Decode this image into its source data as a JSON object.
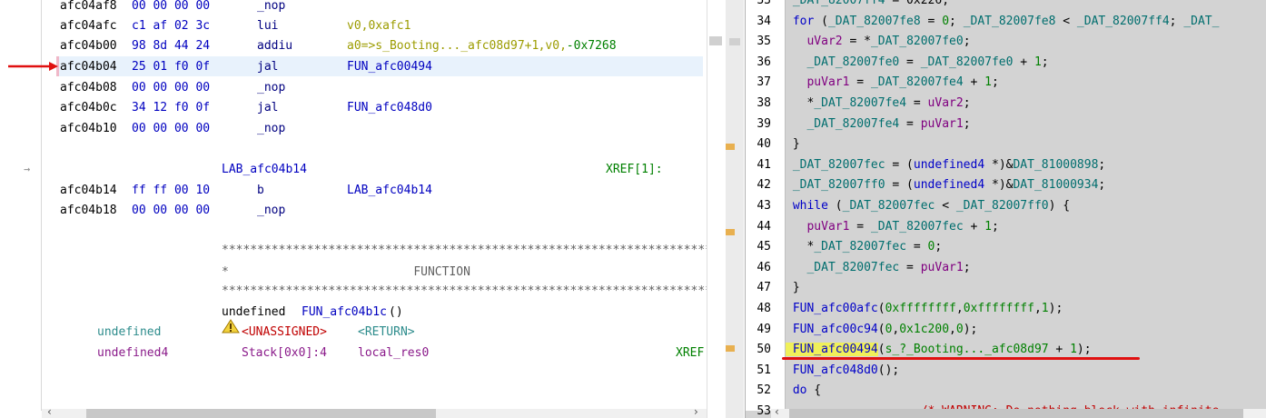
{
  "listing": {
    "rows": [
      {
        "addr": "afc04af8",
        "bytes": "00 00 00 00",
        "mnemonic": "_nop",
        "operand": ""
      },
      {
        "addr": "afc04afc",
        "bytes": "c1 af 02 3c",
        "mnemonic": "lui",
        "operand": "v0,0xafc1"
      },
      {
        "addr": "afc04b00",
        "bytes": "98 8d 44 24",
        "mnemonic": "addiu",
        "operand_a": "a0=>s_Booting..._afc08d97+1",
        "operand_b": ",v0,",
        "operand_c": "-0x7268"
      },
      {
        "addr": "afc04b04",
        "bytes": "25 01 f0 0f",
        "mnemonic": "jal",
        "operand": "FUN_afc00494"
      },
      {
        "addr": "afc04b08",
        "bytes": "00 00 00 00",
        "mnemonic": "_nop",
        "operand": ""
      },
      {
        "addr": "afc04b0c",
        "bytes": "34 12 f0 0f",
        "mnemonic": "jal",
        "operand": "FUN_afc048d0"
      },
      {
        "addr": "afc04b10",
        "bytes": "00 00 00 00",
        "mnemonic": "_nop",
        "operand": ""
      }
    ],
    "label": "LAB_afc04b14",
    "xref": "XREF[1]:",
    "rows2": [
      {
        "addr": "afc04b14",
        "bytes": "ff ff 00 10",
        "mnemonic": "b",
        "operand": "LAB_afc04b14"
      },
      {
        "addr": "afc04b18",
        "bytes": "00 00 00 00",
        "mnemonic": "_nop",
        "operand": ""
      }
    ],
    "stars": "**********************************************************************",
    "function_banner": "*                          FUNCTION",
    "signature_type": "undefined ",
    "signature_name": "FUN_afc04b1c",
    "signature_parens": "()",
    "ret_type": "undefined",
    "unassigned": "<UNASSIGNED>",
    "return_label": "<RETURN>",
    "param_type": "undefined4",
    "stack": "Stack[0x0]:4",
    "local": "local_res0",
    "xref_cut": "XREF"
  },
  "decompiler": {
    "lines": [
      {
        "n": "33",
        "parts": [
          [
            "gl",
            " _DAT_82007ff4"
          ],
          [
            "dc",
            " = 0x226;"
          ]
        ]
      },
      {
        "n": "34",
        "parts": [
          [
            "kw",
            " for"
          ],
          [
            "dc",
            " ("
          ],
          [
            "gl",
            "_DAT_82007fe8"
          ],
          [
            "dc",
            " = "
          ],
          [
            "num",
            "0"
          ],
          [
            "dc",
            "; "
          ],
          [
            "gl",
            "_DAT_82007fe8"
          ],
          [
            "dc",
            " < "
          ],
          [
            "gl",
            "_DAT_82007ff4"
          ],
          [
            "dc",
            "; "
          ],
          [
            "gl",
            "_DAT_"
          ]
        ]
      },
      {
        "n": "35",
        "parts": [
          [
            "var",
            "   uVar2"
          ],
          [
            "dc",
            " = *"
          ],
          [
            "gl",
            "_DAT_82007fe0"
          ],
          [
            "dc",
            ";"
          ]
        ]
      },
      {
        "n": "36",
        "parts": [
          [
            "gl",
            "   _DAT_82007fe0"
          ],
          [
            "dc",
            " = "
          ],
          [
            "gl",
            "_DAT_82007fe0"
          ],
          [
            "dc",
            " + "
          ],
          [
            "num",
            "1"
          ],
          [
            "dc",
            ";"
          ]
        ]
      },
      {
        "n": "37",
        "parts": [
          [
            "var",
            "   puVar1"
          ],
          [
            "dc",
            " = "
          ],
          [
            "gl",
            "_DAT_82007fe4"
          ],
          [
            "dc",
            " + "
          ],
          [
            "num",
            "1"
          ],
          [
            "dc",
            ";"
          ]
        ]
      },
      {
        "n": "38",
        "parts": [
          [
            "dc",
            "   *"
          ],
          [
            "gl",
            "_DAT_82007fe4"
          ],
          [
            "dc",
            " = "
          ],
          [
            "var",
            "uVar2"
          ],
          [
            "dc",
            ";"
          ]
        ]
      },
      {
        "n": "39",
        "parts": [
          [
            "gl",
            "   _DAT_82007fe4"
          ],
          [
            "dc",
            " = "
          ],
          [
            "var",
            "puVar1"
          ],
          [
            "dc",
            ";"
          ]
        ]
      },
      {
        "n": "40",
        "parts": [
          [
            "dc",
            " }"
          ]
        ]
      },
      {
        "n": "41",
        "parts": [
          [
            "gl",
            " _DAT_82007fec"
          ],
          [
            "dc",
            " = ("
          ],
          [
            "ty",
            "undefined4"
          ],
          [
            "dc",
            " *)&"
          ],
          [
            "gl",
            "DAT_81000898"
          ],
          [
            "dc",
            ";"
          ]
        ]
      },
      {
        "n": "42",
        "parts": [
          [
            "gl",
            " _DAT_82007ff0"
          ],
          [
            "dc",
            " = ("
          ],
          [
            "ty",
            "undefined4"
          ],
          [
            "dc",
            " *)&"
          ],
          [
            "gl",
            "DAT_81000934"
          ],
          [
            "dc",
            ";"
          ]
        ]
      },
      {
        "n": "43",
        "parts": [
          [
            "kw",
            " while"
          ],
          [
            "dc",
            " ("
          ],
          [
            "gl",
            "_DAT_82007fec"
          ],
          [
            "dc",
            " < "
          ],
          [
            "gl",
            "_DAT_82007ff0"
          ],
          [
            "dc",
            ") {"
          ]
        ]
      },
      {
        "n": "44",
        "parts": [
          [
            "var",
            "   puVar1"
          ],
          [
            "dc",
            " = "
          ],
          [
            "gl",
            "_DAT_82007fec"
          ],
          [
            "dc",
            " + "
          ],
          [
            "num",
            "1"
          ],
          [
            "dc",
            ";"
          ]
        ]
      },
      {
        "n": "45",
        "parts": [
          [
            "dc",
            "   *"
          ],
          [
            "gl",
            "_DAT_82007fec"
          ],
          [
            "dc",
            " = "
          ],
          [
            "num",
            "0"
          ],
          [
            "dc",
            ";"
          ]
        ]
      },
      {
        "n": "46",
        "parts": [
          [
            "gl",
            "   _DAT_82007fec"
          ],
          [
            "dc",
            " = "
          ],
          [
            "var",
            "puVar1"
          ],
          [
            "dc",
            ";"
          ]
        ]
      },
      {
        "n": "47",
        "parts": [
          [
            "dc",
            " }"
          ]
        ]
      },
      {
        "n": "48",
        "parts": [
          [
            "fn",
            " FUN_afc00afc"
          ],
          [
            "dc",
            "("
          ],
          [
            "num",
            "0xffffffff"
          ],
          [
            "dc",
            ","
          ],
          [
            "num",
            "0xffffffff"
          ],
          [
            "dc",
            ","
          ],
          [
            "num",
            "1"
          ],
          [
            "dc",
            ");"
          ]
        ]
      },
      {
        "n": "49",
        "parts": [
          [
            "fn",
            " FUN_afc00c94"
          ],
          [
            "dc",
            "("
          ],
          [
            "num",
            "0"
          ],
          [
            "dc",
            ","
          ],
          [
            "num",
            "0x1c200"
          ],
          [
            "dc",
            ","
          ],
          [
            "num",
            "0"
          ],
          [
            "dc",
            ");"
          ]
        ]
      },
      {
        "n": "50",
        "parts": [
          [
            "fn",
            " FUN_afc00494"
          ],
          [
            "dc",
            "("
          ],
          [
            "str",
            "s_?_Booting..._afc08d97"
          ],
          [
            "dc",
            " + "
          ],
          [
            "num",
            "1"
          ],
          [
            "dc",
            ");"
          ]
        ]
      },
      {
        "n": "51",
        "parts": [
          [
            "fn",
            " FUN_afc048d0"
          ],
          [
            "dc",
            "();"
          ]
        ]
      },
      {
        "n": "52",
        "parts": [
          [
            "kw",
            " do"
          ],
          [
            "dc",
            " {"
          ]
        ]
      },
      {
        "n": "53",
        "parts": [
          [
            "cm",
            "                   /* WARNING: Do nothing block with infinite"
          ]
        ]
      }
    ]
  }
}
